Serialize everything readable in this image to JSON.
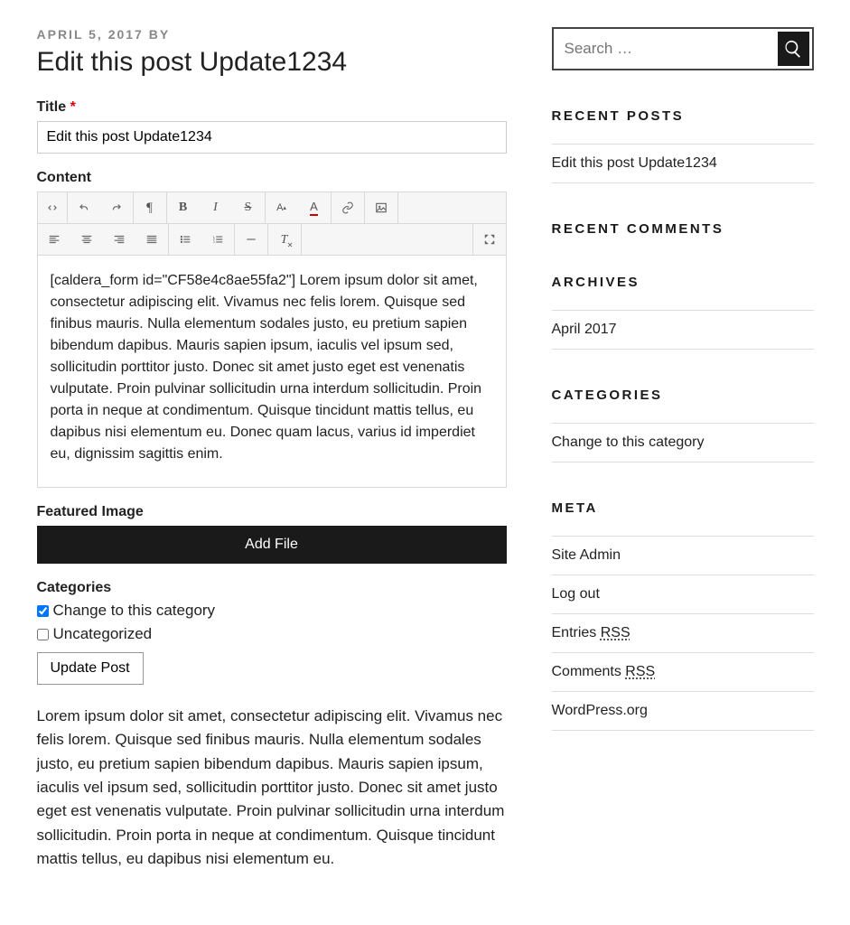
{
  "post": {
    "meta_date": "APRIL 5, 2017",
    "meta_by": "BY",
    "title": "Edit this post Update1234"
  },
  "form": {
    "title_label": "Title",
    "title_value": "Edit this post Update1234",
    "content_label": "Content",
    "content_value": "[caldera_form id=\"CF58e4c8ae55fa2\"] Lorem ipsum dolor sit amet, consectetur adipiscing elit. Vivamus nec felis lorem. Quisque sed finibus mauris. Nulla elementum sodales justo, eu pretium sapien bibendum dapibus. Mauris sapien ipsum, iaculis vel ipsum sed, sollicitudin porttitor justo. Donec sit amet justo eget est venenatis vulputate. Proin pulvinar sollicitudin urna interdum sollicitudin. Proin porta in neque at condimentum. Quisque tincidunt mattis tellus, eu dapibus nisi elementum eu. Donec quam lacus, varius id imperdiet eu, dignissim sagittis enim.",
    "featured_label": "Featured Image",
    "add_file_label": "Add File",
    "categories_label": "Categories",
    "categories": [
      {
        "label": "Change to this category",
        "checked": true
      },
      {
        "label": "Uncategorized",
        "checked": false
      }
    ],
    "submit_label": "Update Post"
  },
  "body_text": "Lorem ipsum dolor sit amet, consectetur adipiscing elit. Vivamus nec felis lorem. Quisque sed finibus mauris. Nulla elementum sodales justo, eu pretium sapien bibendum dapibus. Mauris sapien ipsum, iaculis vel ipsum sed, sollicitudin porttitor justo. Donec sit amet justo eget est venenatis vulputate. Proin pulvinar sollicitudin urna interdum sollicitudin. Proin porta in neque at condimentum. Quisque tincidunt mattis tellus, eu dapibus nisi elementum eu.",
  "sidebar": {
    "search_placeholder": "Search …",
    "recent_posts": {
      "title": "RECENT POSTS",
      "items": [
        "Edit this post Update1234"
      ]
    },
    "recent_comments": {
      "title": "RECENT COMMENTS"
    },
    "archives": {
      "title": "ARCHIVES",
      "items": [
        "April 2017"
      ]
    },
    "categories": {
      "title": "CATEGORIES",
      "items": [
        "Change to this category"
      ]
    },
    "meta": {
      "title": "META",
      "items": [
        {
          "label": "Site Admin"
        },
        {
          "label": "Log out"
        },
        {
          "label": "Entries ",
          "abbr": "RSS"
        },
        {
          "label": "Comments ",
          "abbr": "RSS"
        },
        {
          "label": "WordPress.org"
        }
      ]
    }
  }
}
